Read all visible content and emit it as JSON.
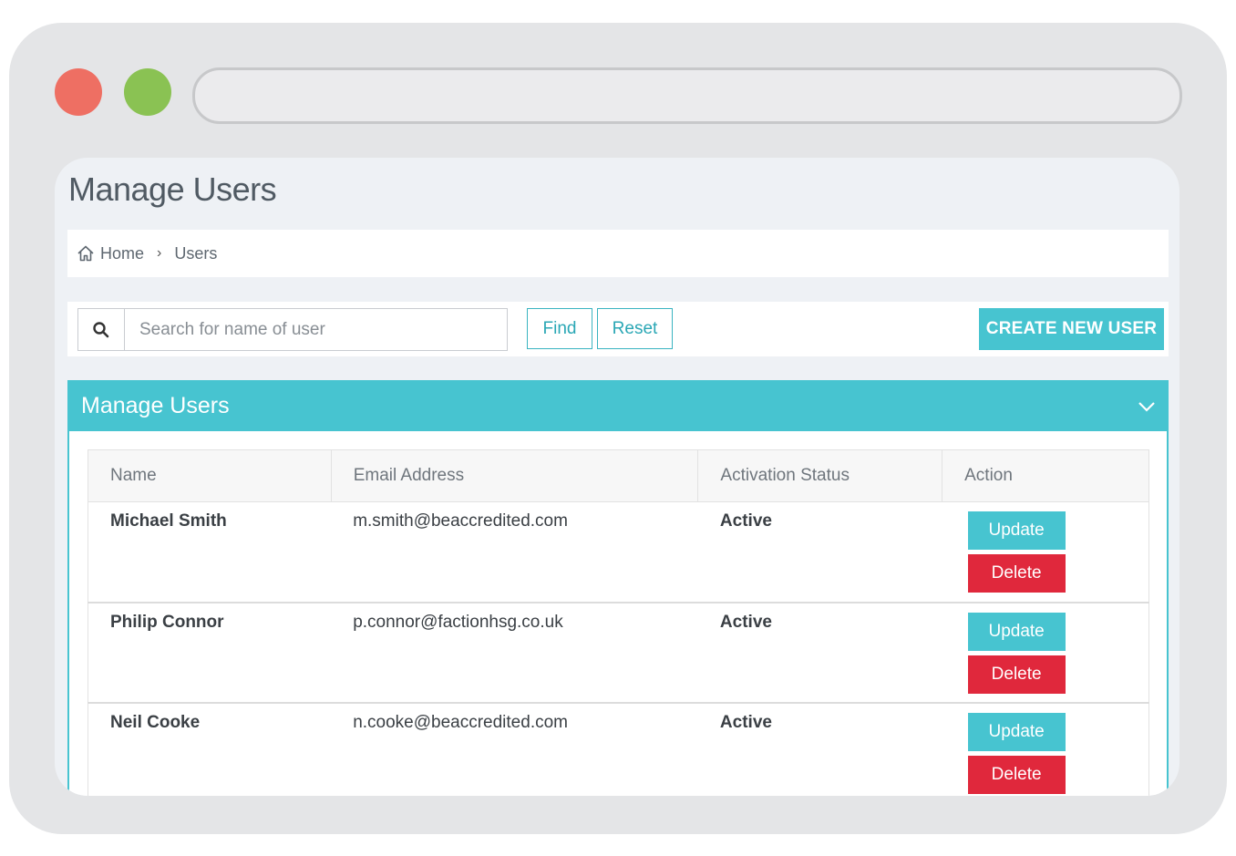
{
  "page": {
    "title": "Manage Users"
  },
  "breadcrumb": {
    "home": "Home",
    "current": "Users"
  },
  "search": {
    "placeholder": "Search for name of user",
    "value": ""
  },
  "toolbar": {
    "find_label": "Find",
    "reset_label": "Reset",
    "create_label": "CREATE NEW USER"
  },
  "panel": {
    "title": "Manage Users"
  },
  "table": {
    "headers": {
      "name": "Name",
      "email": "Email Address",
      "status": "Activation Status",
      "action": "Action"
    },
    "rows": [
      {
        "name": "Michael Smith",
        "email": "m.smith@beaccredited.com",
        "status": "Active",
        "update": "Update",
        "delete": "Delete"
      },
      {
        "name": "Philip Connor",
        "email": "p.connor@factionhsg.co.uk",
        "status": "Active",
        "update": "Update",
        "delete": "Delete"
      },
      {
        "name": "Neil Cooke",
        "email": "n.cooke@beaccredited.com",
        "status": "Active",
        "update": "Update",
        "delete": "Delete"
      }
    ]
  },
  "colors": {
    "accent": "#47c4d0",
    "danger": "#e0283c",
    "active_status": "#24962c",
    "window_dot_red": "#ee6f63",
    "window_dot_green": "#8ac253"
  },
  "icons": {
    "breadcrumb_home": "home-icon",
    "breadcrumb_separator": "chevron-right-icon",
    "search": "search-icon",
    "panel_toggle": "chevron-down-icon"
  }
}
